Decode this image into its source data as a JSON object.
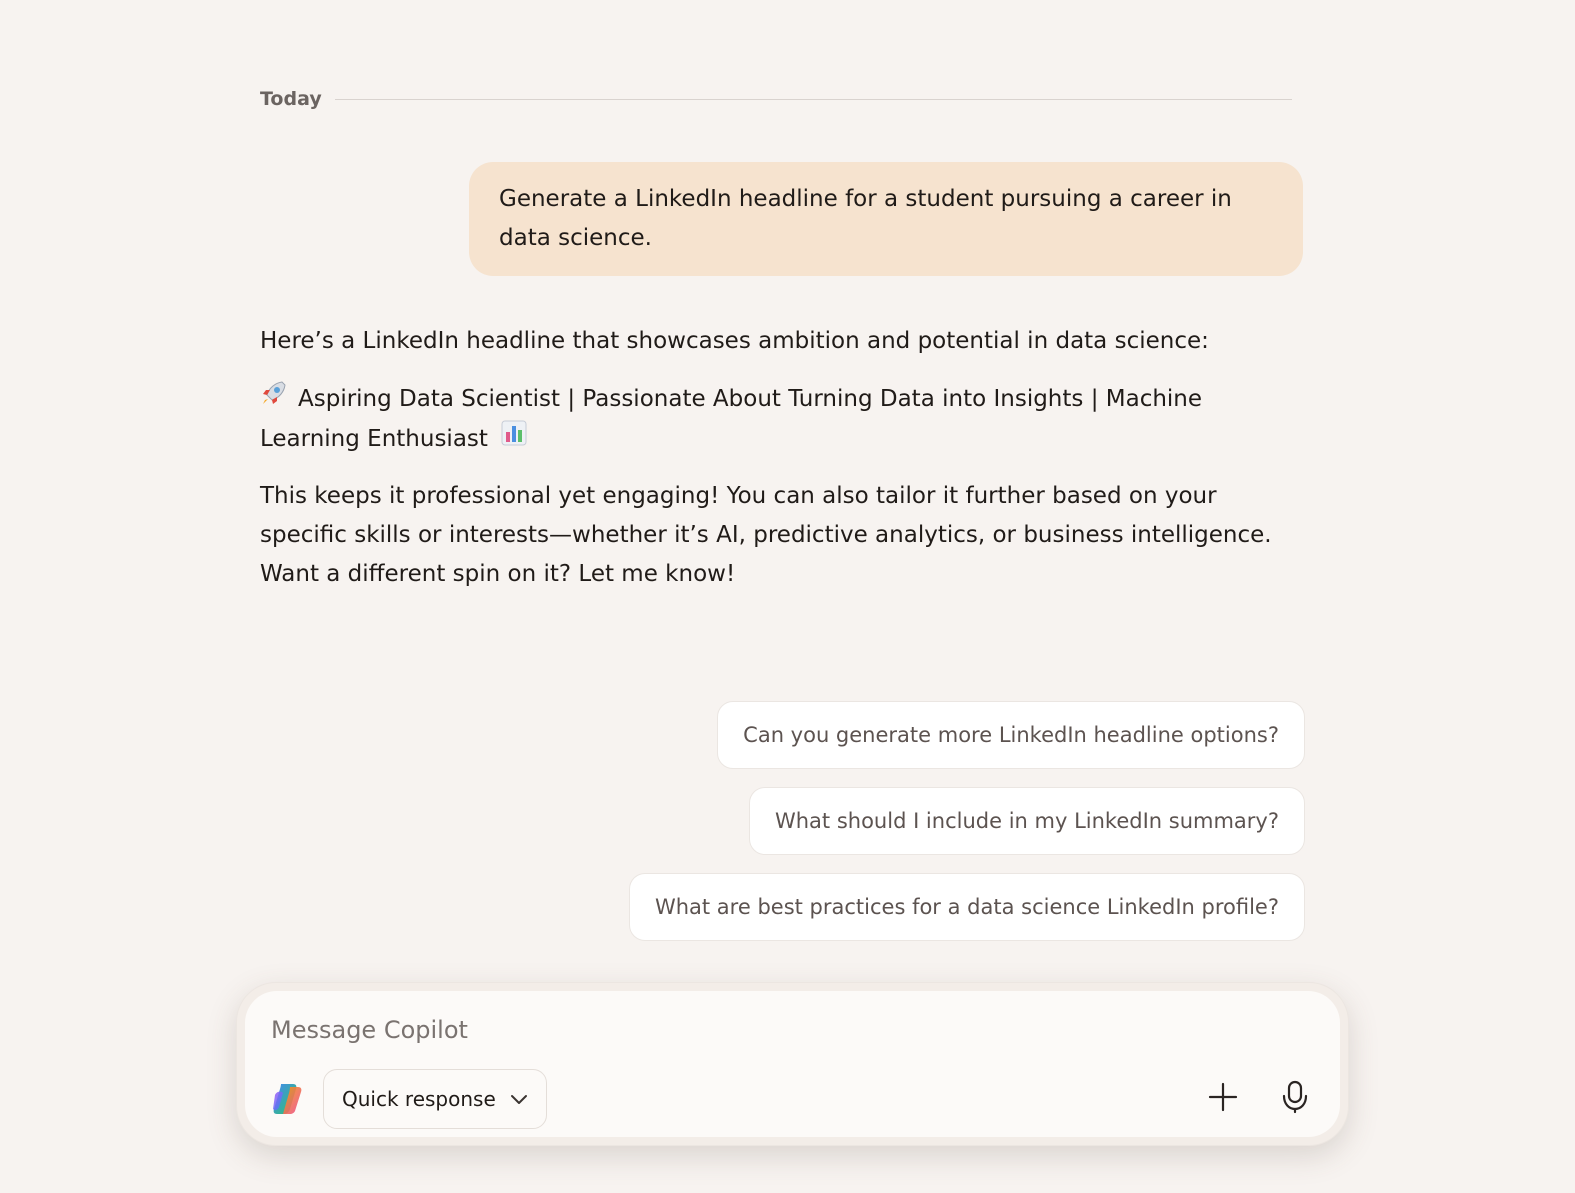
{
  "divider": {
    "label": "Today"
  },
  "conversation": {
    "user_message": "Generate a LinkedIn headline for a student pursuing a career in data science.",
    "assistant": {
      "intro": "Here’s a LinkedIn headline that showcases ambition and potential in data science:",
      "headline_line1": "Aspiring Data Scientist | Passionate About Turning Data into Insights | Machine",
      "headline_line2": "Learning Enthusiast",
      "headline_emoji_start": "rocket-emoji",
      "headline_emoji_end": "bar-chart-emoji",
      "closing": "This keeps it professional yet engaging! You can also tailor it further based on your specific skills or interests—whether it’s AI, predictive analytics, or business intelligence. Want a different spin on it? Let me know!"
    }
  },
  "suggestions": [
    {
      "label": "Can you generate more LinkedIn headline options?"
    },
    {
      "label": "What should I include in my LinkedIn summary?"
    },
    {
      "label": "What are best practices for a data science LinkedIn profile?"
    }
  ],
  "composer": {
    "placeholder": "Message Copilot",
    "value": "",
    "mode_label": "Quick response",
    "icons": {
      "logo": "copilot-logo-icon",
      "mode_chevron": "chevron-down-icon",
      "add": "plus-icon",
      "mic": "microphone-icon"
    }
  },
  "colors": {
    "page_background": "#f7f3f0",
    "user_bubble": "#f6e3cf",
    "chip_background": "#ffffff",
    "chip_text": "#5c5350",
    "divider_text": "#6b6461"
  }
}
